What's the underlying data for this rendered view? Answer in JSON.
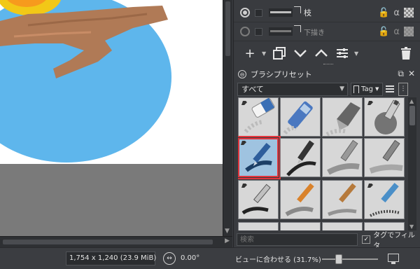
{
  "layers": [
    {
      "name": "枝",
      "visible": true
    },
    {
      "name": "下描き",
      "visible": false
    }
  ],
  "layer_toolbar": {
    "add_icon": "plus-icon",
    "duplicate_icon": "duplicate-icon",
    "move_down_icon": "chevron-down-icon",
    "move_up_icon": "chevron-up-icon",
    "properties_icon": "sliders-icon",
    "delete_icon": "trash-icon"
  },
  "alpha_symbol": "α",
  "lock_symbol": "🔓",
  "preset_docker": {
    "title": "ブラシプリセット",
    "tag_value": "すべて",
    "tag_button_label": "Tag",
    "search_placeholder": "検索",
    "filter_label": "タグでフィルタ",
    "filter_checked": "✓"
  },
  "status_bar": {
    "dimensions": "1,754 x 1,240 (23.9 MiB)",
    "rotation": "0.00°",
    "zoom_label": "ビューに合わせる (31.7%)"
  },
  "colors": {
    "sky": "#5eb6ec",
    "branch": "#b07a56",
    "sun_ring": "#f2c817",
    "sun_core": "#f79a1d",
    "selected_border": "#e3363d"
  }
}
